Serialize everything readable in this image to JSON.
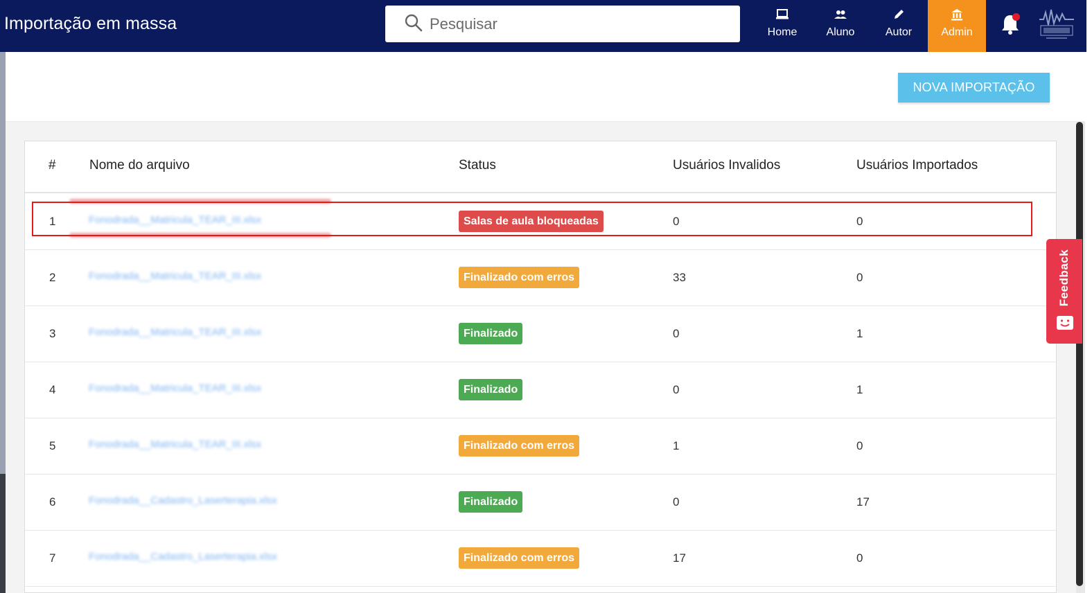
{
  "header": {
    "title": "Importação em massa",
    "search_placeholder": "Pesquisar",
    "nav": [
      {
        "label": "Home",
        "icon": "laptop-icon",
        "active": false
      },
      {
        "label": "Aluno",
        "icon": "users-icon",
        "active": false
      },
      {
        "label": "Autor",
        "icon": "pencil-icon",
        "active": false
      },
      {
        "label": "Admin",
        "icon": "bank-icon",
        "active": true
      }
    ],
    "colors": {
      "bar": "#0b1a5c",
      "active": "#f5921e"
    }
  },
  "toolbar": {
    "new_import_label": "NOVA IMPORTAÇÃO"
  },
  "table": {
    "columns": [
      "#",
      "Nome do arquivo",
      "Status",
      "Usuários Invalidos",
      "Usuários Importados"
    ],
    "rows": [
      {
        "num": "1",
        "file": "Fonodrada__Matricula_TEAR_III.xlsx",
        "status": "Salas de aula bloqueadas",
        "status_color": "red",
        "invalid": "0",
        "imported": "0"
      },
      {
        "num": "2",
        "file": "Fonodrada__Matricula_TEAR_III.xlsx",
        "status": "Finalizado com erros",
        "status_color": "orange",
        "invalid": "33",
        "imported": "0"
      },
      {
        "num": "3",
        "file": "Fonodrada__Matricula_TEAR_III.xlsx",
        "status": "Finalizado",
        "status_color": "green",
        "invalid": "0",
        "imported": "1"
      },
      {
        "num": "4",
        "file": "Fonodrada__Matricula_TEAR_III.xlsx",
        "status": "Finalizado",
        "status_color": "green",
        "invalid": "0",
        "imported": "1"
      },
      {
        "num": "5",
        "file": "Fonodrada__Matricula_TEAR_III.xlsx",
        "status": "Finalizado com erros",
        "status_color": "orange",
        "invalid": "1",
        "imported": "0"
      },
      {
        "num": "6",
        "file": "Fonodrada__Cadastro_Laserterapia.xlsx",
        "status": "Finalizado",
        "status_color": "green",
        "invalid": "0",
        "imported": "17"
      },
      {
        "num": "7",
        "file": "Fonodrada__Cadastro_Laserterapia.xlsx",
        "status": "Finalizado com erros",
        "status_color": "orange",
        "invalid": "17",
        "imported": "0"
      }
    ]
  },
  "feedback": {
    "label": "Feedback",
    "icon": "smile-icon"
  },
  "status_colors": {
    "red": "#de4b4b",
    "orange": "#f2a93b",
    "green": "#4caa52"
  }
}
